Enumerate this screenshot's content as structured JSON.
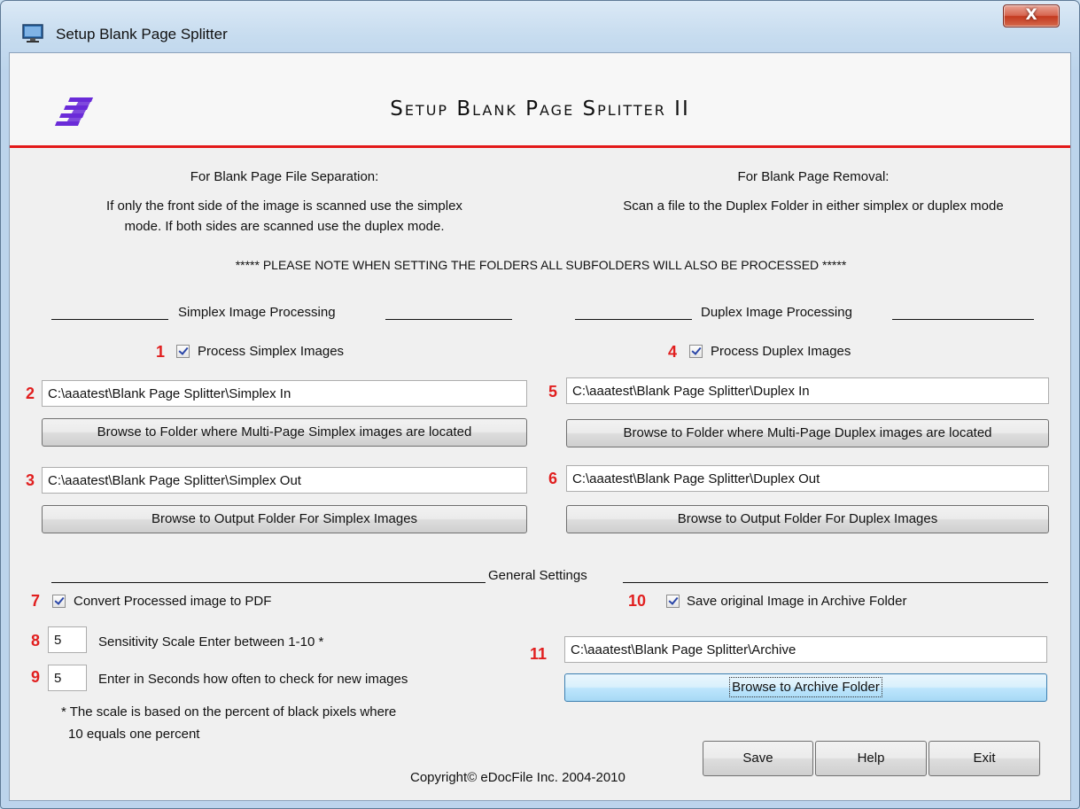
{
  "window": {
    "title": "Setup Blank Page Splitter",
    "close_glyph": "X",
    "header_title": "Setup Blank Page Splitter II"
  },
  "left_intro": {
    "heading": "For Blank Page File Separation:",
    "line1": "If only the front side of the image is scanned use the simplex",
    "line2": "mode. If both sides are scanned use the duplex mode."
  },
  "right_intro": {
    "heading": "For Blank Page Removal:",
    "line1": "Scan a file to the Duplex Folder in either simplex or duplex mode"
  },
  "note": "***** PLEASE NOTE WHEN SETTING THE FOLDERS ALL SUBFOLDERS WILL ALSO BE PROCESSED *****",
  "simplex": {
    "section_title": "Simplex Image Processing",
    "process_label": "Process Simplex Images",
    "process_checked": true,
    "input_folder": "C:\\aaatest\\Blank Page Splitter\\Simplex In",
    "browse_input_label": "Browse to Folder where Multi-Page Simplex images are located",
    "output_folder": "C:\\aaatest\\Blank Page Splitter\\Simplex Out",
    "browse_output_label": "Browse to Output Folder For Simplex Images"
  },
  "duplex": {
    "section_title": "Duplex Image Processing",
    "process_label": "Process Duplex Images",
    "process_checked": true,
    "input_folder": "C:\\aaatest\\Blank Page Splitter\\Duplex In",
    "browse_input_label": "Browse to Folder where Multi-Page Duplex images are located",
    "output_folder": "C:\\aaatest\\Blank Page Splitter\\Duplex Out",
    "browse_output_label": "Browse to Output Folder For Duplex Images"
  },
  "general": {
    "section_title": "General Settings",
    "convert_pdf_label": "Convert Processed image to PDF",
    "convert_pdf_checked": true,
    "sensitivity_value": "5",
    "sensitivity_label": "Sensitivity Scale Enter between 1-10 *",
    "interval_value": "5",
    "interval_label": "Enter in Seconds how often to check for new images",
    "footnote_line1": "* The scale is based on the percent of black pixels where",
    "footnote_line2": "10 equals one percent",
    "archive_label": "Save original Image in Archive Folder",
    "archive_checked": true,
    "archive_folder": "C:\\aaatest\\Blank Page Splitter\\Archive",
    "browse_archive_label": "Browse to Archive Folder"
  },
  "markers": [
    "1",
    "2",
    "3",
    "4",
    "5",
    "6",
    "7",
    "8",
    "9",
    "10",
    "11"
  ],
  "footer": {
    "copyright": "Copyright© eDocFile Inc. 2004-2010",
    "save_label": "Save",
    "help_label": "Help",
    "exit_label": "Exit"
  },
  "colors": {
    "marker_red": "#e11f1f",
    "header_rule": "#e31919",
    "logo_purple": "#6a2bd8",
    "check_blue": "#2a46a8"
  },
  "icons": {
    "app": "monitor-icon",
    "logo": "slanted-bars-logo",
    "close": "close-icon",
    "check": "checkmark-icon"
  }
}
